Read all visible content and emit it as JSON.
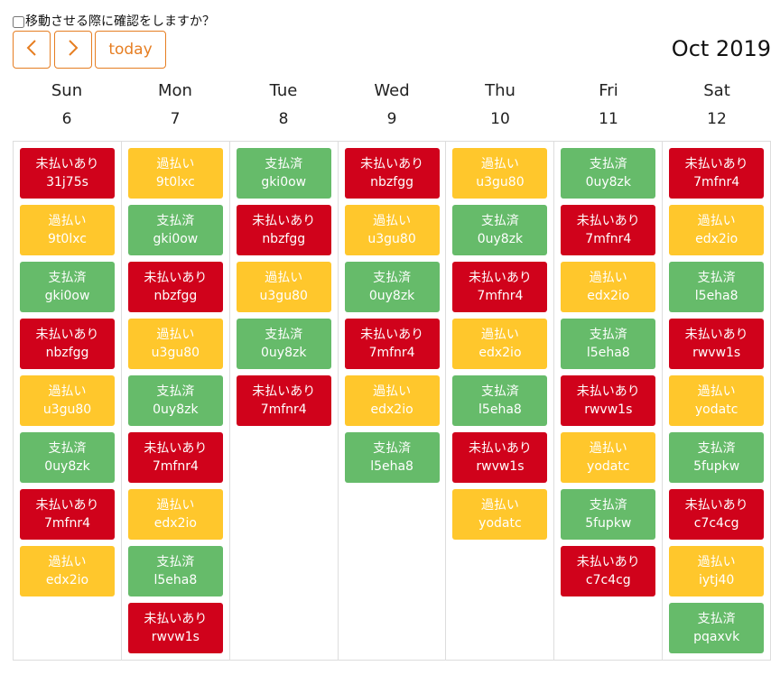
{
  "confirm": {
    "label": "移動させる際に確認をしますか？",
    "checked": false
  },
  "toolbar": {
    "prev_icon": "chevron-left-icon",
    "next_icon": "chevron-right-icon",
    "today_label": "today",
    "title": "Oct 2019"
  },
  "colors": {
    "accent": "#e67e22",
    "red": "#d0021b",
    "yellow": "#ffc72c",
    "green": "#66bb6a"
  },
  "days": [
    {
      "dow": "Sun",
      "date": "6",
      "events": [
        {
          "status": "未払いあり",
          "id": "31j75s",
          "color": "red"
        },
        {
          "status": "過払い",
          "id": "9t0lxc",
          "color": "yellow"
        },
        {
          "status": "支払済",
          "id": "gki0ow",
          "color": "green"
        },
        {
          "status": "未払いあり",
          "id": "nbzfgg",
          "color": "red"
        },
        {
          "status": "過払い",
          "id": "u3gu80",
          "color": "yellow"
        },
        {
          "status": "支払済",
          "id": "0uy8zk",
          "color": "green"
        },
        {
          "status": "未払いあり",
          "id": "7mfnr4",
          "color": "red"
        },
        {
          "status": "過払い",
          "id": "edx2io",
          "color": "yellow"
        }
      ]
    },
    {
      "dow": "Mon",
      "date": "7",
      "events": [
        {
          "status": "過払い",
          "id": "9t0lxc",
          "color": "yellow"
        },
        {
          "status": "支払済",
          "id": "gki0ow",
          "color": "green"
        },
        {
          "status": "未払いあり",
          "id": "nbzfgg",
          "color": "red"
        },
        {
          "status": "過払い",
          "id": "u3gu80",
          "color": "yellow"
        },
        {
          "status": "支払済",
          "id": "0uy8zk",
          "color": "green"
        },
        {
          "status": "未払いあり",
          "id": "7mfnr4",
          "color": "red"
        },
        {
          "status": "過払い",
          "id": "edx2io",
          "color": "yellow"
        },
        {
          "status": "支払済",
          "id": "l5eha8",
          "color": "green"
        },
        {
          "status": "未払いあり",
          "id": "rwvw1s",
          "color": "red"
        }
      ]
    },
    {
      "dow": "Tue",
      "date": "8",
      "events": [
        {
          "status": "支払済",
          "id": "gki0ow",
          "color": "green"
        },
        {
          "status": "未払いあり",
          "id": "nbzfgg",
          "color": "red"
        },
        {
          "status": "過払い",
          "id": "u3gu80",
          "color": "yellow"
        },
        {
          "status": "支払済",
          "id": "0uy8zk",
          "color": "green"
        },
        {
          "status": "未払いあり",
          "id": "7mfnr4",
          "color": "red"
        }
      ]
    },
    {
      "dow": "Wed",
      "date": "9",
      "events": [
        {
          "status": "未払いあり",
          "id": "nbzfgg",
          "color": "red"
        },
        {
          "status": "過払い",
          "id": "u3gu80",
          "color": "yellow"
        },
        {
          "status": "支払済",
          "id": "0uy8zk",
          "color": "green"
        },
        {
          "status": "未払いあり",
          "id": "7mfnr4",
          "color": "red"
        },
        {
          "status": "過払い",
          "id": "edx2io",
          "color": "yellow"
        },
        {
          "status": "支払済",
          "id": "l5eha8",
          "color": "green"
        }
      ]
    },
    {
      "dow": "Thu",
      "date": "10",
      "events": [
        {
          "status": "過払い",
          "id": "u3gu80",
          "color": "yellow"
        },
        {
          "status": "支払済",
          "id": "0uy8zk",
          "color": "green"
        },
        {
          "status": "未払いあり",
          "id": "7mfnr4",
          "color": "red"
        },
        {
          "status": "過払い",
          "id": "edx2io",
          "color": "yellow"
        },
        {
          "status": "支払済",
          "id": "l5eha8",
          "color": "green"
        },
        {
          "status": "未払いあり",
          "id": "rwvw1s",
          "color": "red"
        },
        {
          "status": "過払い",
          "id": "yodatc",
          "color": "yellow"
        }
      ]
    },
    {
      "dow": "Fri",
      "date": "11",
      "events": [
        {
          "status": "支払済",
          "id": "0uy8zk",
          "color": "green"
        },
        {
          "status": "未払いあり",
          "id": "7mfnr4",
          "color": "red"
        },
        {
          "status": "過払い",
          "id": "edx2io",
          "color": "yellow"
        },
        {
          "status": "支払済",
          "id": "l5eha8",
          "color": "green"
        },
        {
          "status": "未払いあり",
          "id": "rwvw1s",
          "color": "red"
        },
        {
          "status": "過払い",
          "id": "yodatc",
          "color": "yellow"
        },
        {
          "status": "支払済",
          "id": "5fupkw",
          "color": "green"
        },
        {
          "status": "未払いあり",
          "id": "c7c4cg",
          "color": "red"
        }
      ]
    },
    {
      "dow": "Sat",
      "date": "12",
      "events": [
        {
          "status": "未払いあり",
          "id": "7mfnr4",
          "color": "red"
        },
        {
          "status": "過払い",
          "id": "edx2io",
          "color": "yellow"
        },
        {
          "status": "支払済",
          "id": "l5eha8",
          "color": "green"
        },
        {
          "status": "未払いあり",
          "id": "rwvw1s",
          "color": "red"
        },
        {
          "status": "過払い",
          "id": "yodatc",
          "color": "yellow"
        },
        {
          "status": "支払済",
          "id": "5fupkw",
          "color": "green"
        },
        {
          "status": "未払いあり",
          "id": "c7c4cg",
          "color": "red"
        },
        {
          "status": "過払い",
          "id": "iytj40",
          "color": "yellow"
        },
        {
          "status": "支払済",
          "id": "pqaxvk",
          "color": "green"
        }
      ]
    }
  ]
}
